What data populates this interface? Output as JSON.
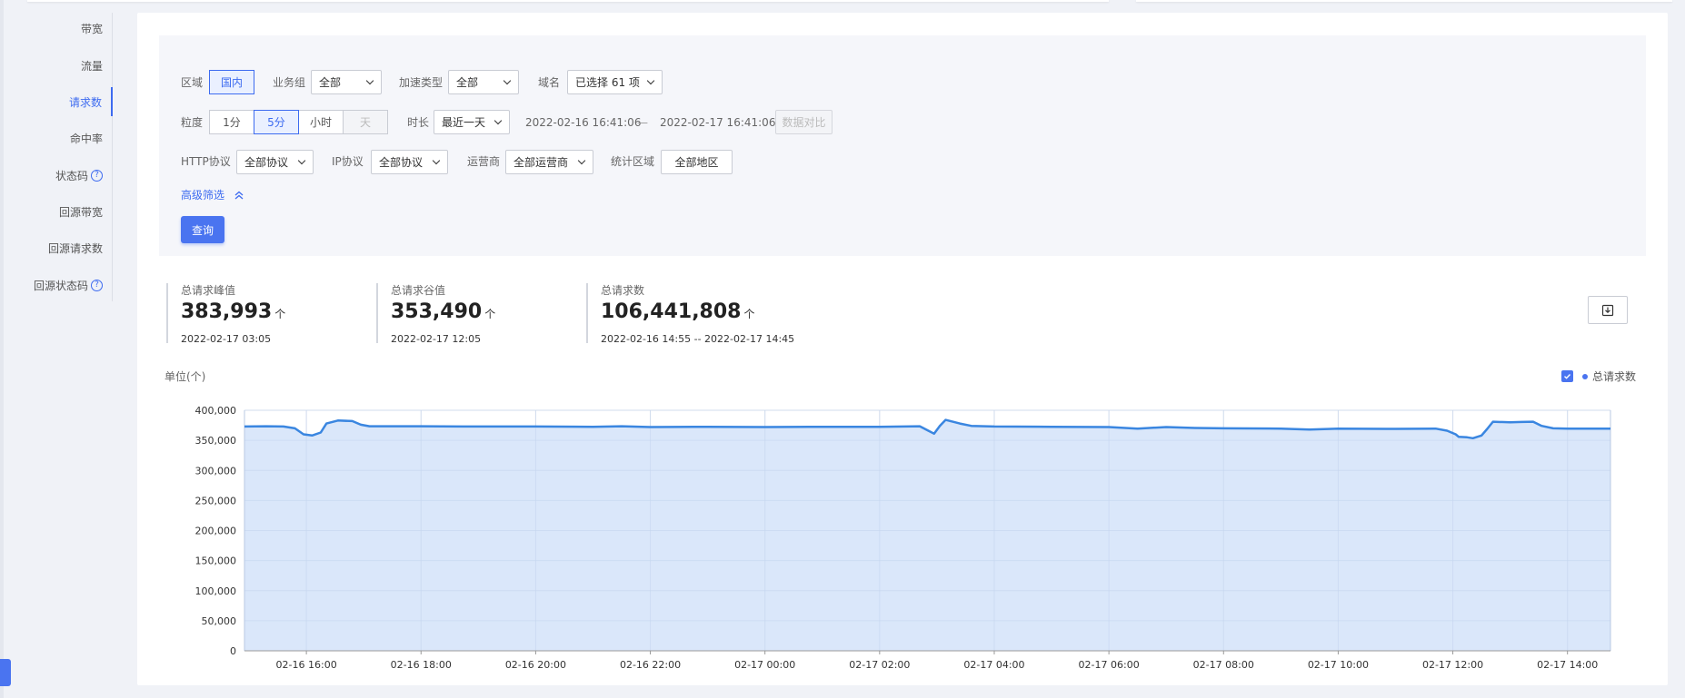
{
  "sidebar": {
    "items": [
      {
        "label": "带宽",
        "active": false,
        "help": false
      },
      {
        "label": "流量",
        "active": false,
        "help": false
      },
      {
        "label": "请求数",
        "active": true,
        "help": false
      },
      {
        "label": "命中率",
        "active": false,
        "help": false
      },
      {
        "label": "状态码",
        "active": false,
        "help": true
      },
      {
        "label": "回源带宽",
        "active": false,
        "help": false
      },
      {
        "label": "回源请求数",
        "active": false,
        "help": false
      },
      {
        "label": "回源状态码",
        "active": false,
        "help": true
      }
    ],
    "help_glyph": "?"
  },
  "filters": {
    "region": {
      "label": "区域",
      "value": "国内"
    },
    "business_group": {
      "label": "业务组",
      "value": "全部"
    },
    "accel_type": {
      "label": "加速类型",
      "value": "全部"
    },
    "domain": {
      "label": "域名",
      "value": "已选择 61 项"
    },
    "granularity": {
      "label": "粒度",
      "options": [
        "1分",
        "5分",
        "小时",
        "天"
      ],
      "selected": "5分",
      "disabled": "天"
    },
    "duration": {
      "label": "时长",
      "value": "最近一天"
    },
    "date_start": "2022-02-16 16:41:06",
    "date_sep": "—",
    "date_end": "2022-02-17 16:41:06",
    "compare_button": "数据对比",
    "http_protocol": {
      "label": "HTTP协议",
      "value": "全部协议"
    },
    "ip_protocol": {
      "label": "IP协议",
      "value": "全部协议"
    },
    "isp": {
      "label": "运营商",
      "value": "全部运营商"
    },
    "stat_region": {
      "label": "统计区域",
      "value": "全部地区"
    },
    "advanced": "高级筛选",
    "query_button": "查询"
  },
  "stats": [
    {
      "title": "总请求峰值",
      "value": "383,993",
      "unit": "个",
      "time": "2022-02-17 03:05"
    },
    {
      "title": "总请求谷值",
      "value": "353,490",
      "unit": "个",
      "time": "2022-02-17 12:05"
    },
    {
      "title": "总请求数",
      "value": "106,441,808",
      "unit": "个",
      "time": "2022-02-16 14:55 -- 2022-02-17 14:45"
    }
  ],
  "download_icon": "download-icon",
  "colors": {
    "accent": "#3d6bf0",
    "line": "#3a86e0",
    "area": "#d8e6fa"
  },
  "chart_data": {
    "type": "area",
    "ylabel": "单位(个)",
    "ylim": [
      0,
      400000
    ],
    "yticks": [
      0,
      50000,
      100000,
      150000,
      200000,
      250000,
      300000,
      350000,
      400000
    ],
    "ytick_labels": [
      "0",
      "50,000",
      "100,000",
      "150,000",
      "200,000",
      "250,000",
      "300,000",
      "350,000",
      "400,000"
    ],
    "xlim_hours": [
      14.92,
      38.75
    ],
    "xticks": [
      "02-16 16:00",
      "02-16 18:00",
      "02-16 20:00",
      "02-16 22:00",
      "02-17 00:00",
      "02-17 02:00",
      "02-17 04:00",
      "02-17 06:00",
      "02-17 08:00",
      "02-17 10:00",
      "02-17 12:00",
      "02-17 14:00"
    ],
    "grid": true,
    "legend_position": "top-right",
    "series": [
      {
        "name": "总请求数",
        "points": [
          [
            14.92,
            373000
          ],
          [
            15.3,
            373500
          ],
          [
            15.6,
            373000
          ],
          [
            15.8,
            370000
          ],
          [
            15.95,
            360000
          ],
          [
            16.1,
            358000
          ],
          [
            16.25,
            363000
          ],
          [
            16.35,
            378000
          ],
          [
            16.55,
            383000
          ],
          [
            16.8,
            382000
          ],
          [
            16.95,
            376000
          ],
          [
            17.1,
            373500
          ],
          [
            18.0,
            373500
          ],
          [
            19.0,
            373000
          ],
          [
            20.0,
            373000
          ],
          [
            21.0,
            372500
          ],
          [
            21.5,
            373500
          ],
          [
            22.0,
            372000
          ],
          [
            23.0,
            372500
          ],
          [
            24.0,
            372000
          ],
          [
            25.0,
            372500
          ],
          [
            26.0,
            372500
          ],
          [
            26.7,
            373500
          ],
          [
            26.85,
            366000
          ],
          [
            26.95,
            361000
          ],
          [
            27.05,
            374000
          ],
          [
            27.15,
            383993
          ],
          [
            27.4,
            378000
          ],
          [
            27.6,
            374000
          ],
          [
            28.0,
            373000
          ],
          [
            29.0,
            372500
          ],
          [
            30.0,
            372000
          ],
          [
            30.5,
            369500
          ],
          [
            31.0,
            372000
          ],
          [
            31.5,
            370500
          ],
          [
            32.0,
            370000
          ],
          [
            33.0,
            369500
          ],
          [
            33.5,
            368000
          ],
          [
            34.0,
            369500
          ],
          [
            35.0,
            369000
          ],
          [
            35.7,
            369500
          ],
          [
            35.9,
            366000
          ],
          [
            36.05,
            360000
          ],
          [
            36.1,
            356000
          ],
          [
            36.25,
            355000
          ],
          [
            36.35,
            353490
          ],
          [
            36.5,
            358000
          ],
          [
            36.6,
            369000
          ],
          [
            36.7,
            381000
          ],
          [
            37.0,
            380000
          ],
          [
            37.2,
            380500
          ],
          [
            37.4,
            381000
          ],
          [
            37.55,
            374000
          ],
          [
            37.75,
            370000
          ],
          [
            38.0,
            369500
          ],
          [
            38.4,
            369500
          ],
          [
            38.75,
            369500
          ]
        ]
      }
    ]
  }
}
